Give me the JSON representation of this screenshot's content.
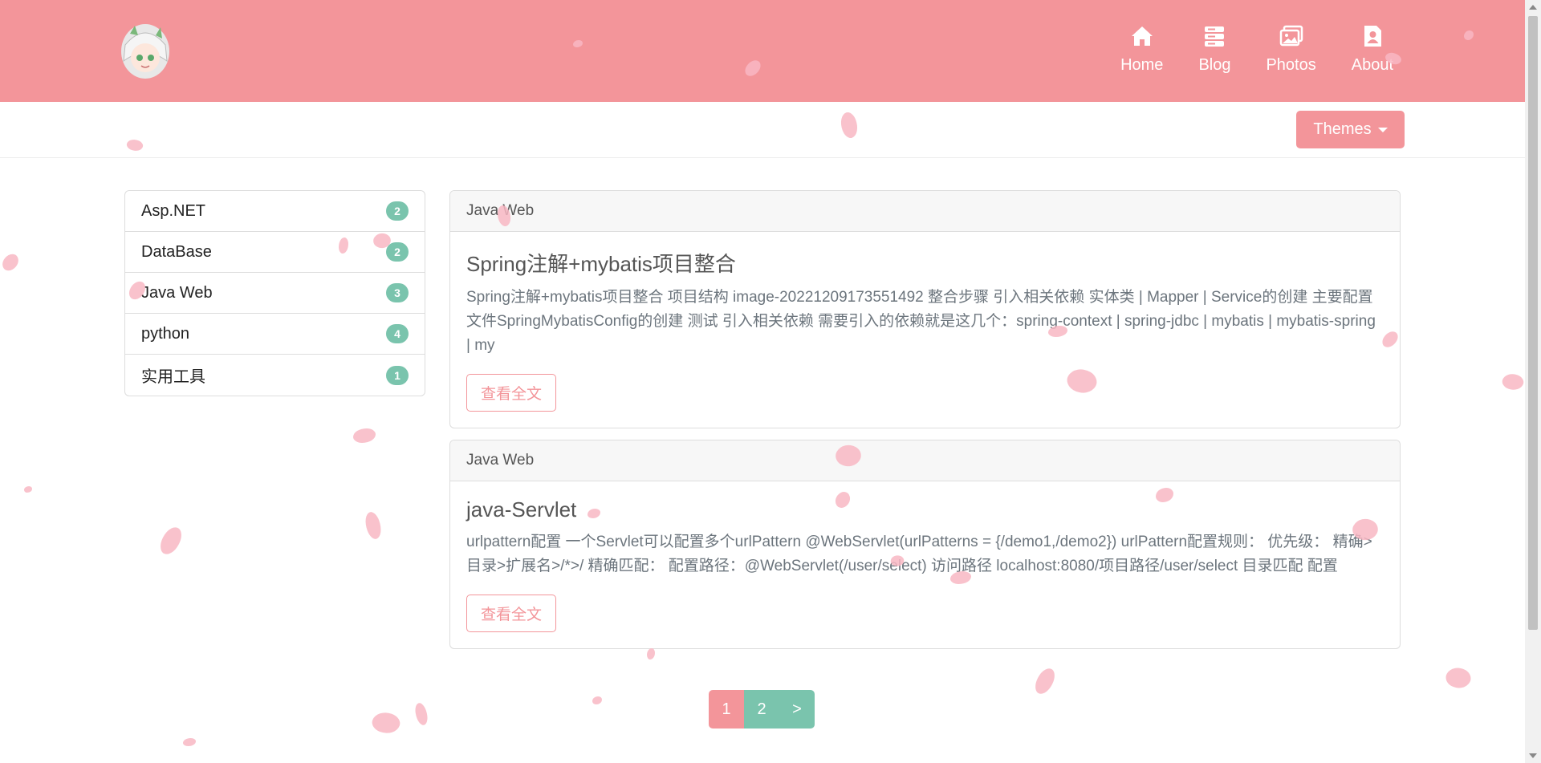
{
  "nav": {
    "items": [
      {
        "label": "Home",
        "icon": "home-icon"
      },
      {
        "label": "Blog",
        "icon": "blog-icon"
      },
      {
        "label": "Photos",
        "icon": "photos-icon"
      },
      {
        "label": "About",
        "icon": "about-icon"
      }
    ]
  },
  "themes": {
    "label": "Themes"
  },
  "categories": [
    {
      "name": "Asp.NET",
      "count": "2"
    },
    {
      "name": "DataBase",
      "count": "2"
    },
    {
      "name": "Java Web",
      "count": "3"
    },
    {
      "name": "python",
      "count": "4"
    },
    {
      "name": "实用工具",
      "count": "1"
    }
  ],
  "posts": [
    {
      "category": "Java Web",
      "title": "Spring注解+mybatis项目整合",
      "excerpt": "Spring注解+mybatis项目整合 项目结构 image-20221209173551492 整合步骤 引入相关依赖 实体类 | Mapper | Service的创建 主要配置文件SpringMybatisConfig的创建 测试 引入相关依赖 需要引入的依赖就是这几个：spring-context | spring-jdbc | mybatis | mybatis-spring | my",
      "read_more": "查看全文"
    },
    {
      "category": "Java Web",
      "title": "java-Servlet",
      "excerpt": "urlpattern配置 一个Servlet可以配置多个urlPattern @WebServlet(urlPatterns = {/demo1,/demo2}) urlPattern配置规则： 优先级： 精确>目录>扩展名>/*>/ 精确匹配： 配置路径：@WebServlet(/user/select) 访问路径 localhost:8080/项目路径/user/select 目录匹配 配置",
      "read_more": "查看全文"
    }
  ],
  "pagination": {
    "pages": [
      "1",
      "2"
    ],
    "next": ">",
    "current": "1"
  },
  "colors": {
    "primary": "#f3959a",
    "accent": "#7ac4ad"
  }
}
